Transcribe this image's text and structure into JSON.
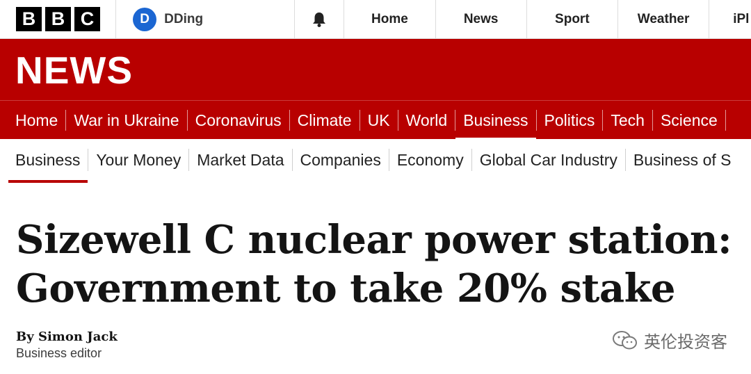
{
  "masthead": {
    "logo_letters": [
      "B",
      "B",
      "C"
    ],
    "account": {
      "initial": "D",
      "name": "DDing"
    },
    "bell_icon": "bell-icon",
    "links": [
      "Home",
      "News",
      "Sport",
      "Weather",
      "iPl"
    ]
  },
  "banner": {
    "title": "NEWS"
  },
  "primary_nav": {
    "items": [
      "Home",
      "War in Ukraine",
      "Coronavirus",
      "Climate",
      "UK",
      "World",
      "Business",
      "Politics",
      "Tech",
      "Science"
    ],
    "active": "Business"
  },
  "secondary_nav": {
    "items": [
      "Business",
      "Your Money",
      "Market Data",
      "Companies",
      "Economy",
      "Global Car Industry",
      "Business of S"
    ],
    "active": "Business"
  },
  "article": {
    "headline_line1": "Sizewell C nuclear power station:",
    "headline_line2": "Government to take 20% stake",
    "byline": "By Simon Jack",
    "role": "Business editor"
  },
  "watermark": {
    "text": "英伦投资客",
    "icon": "wechat-icon"
  },
  "colors": {
    "brand_red": "#b80000",
    "account_blue": "#1b66d2"
  }
}
